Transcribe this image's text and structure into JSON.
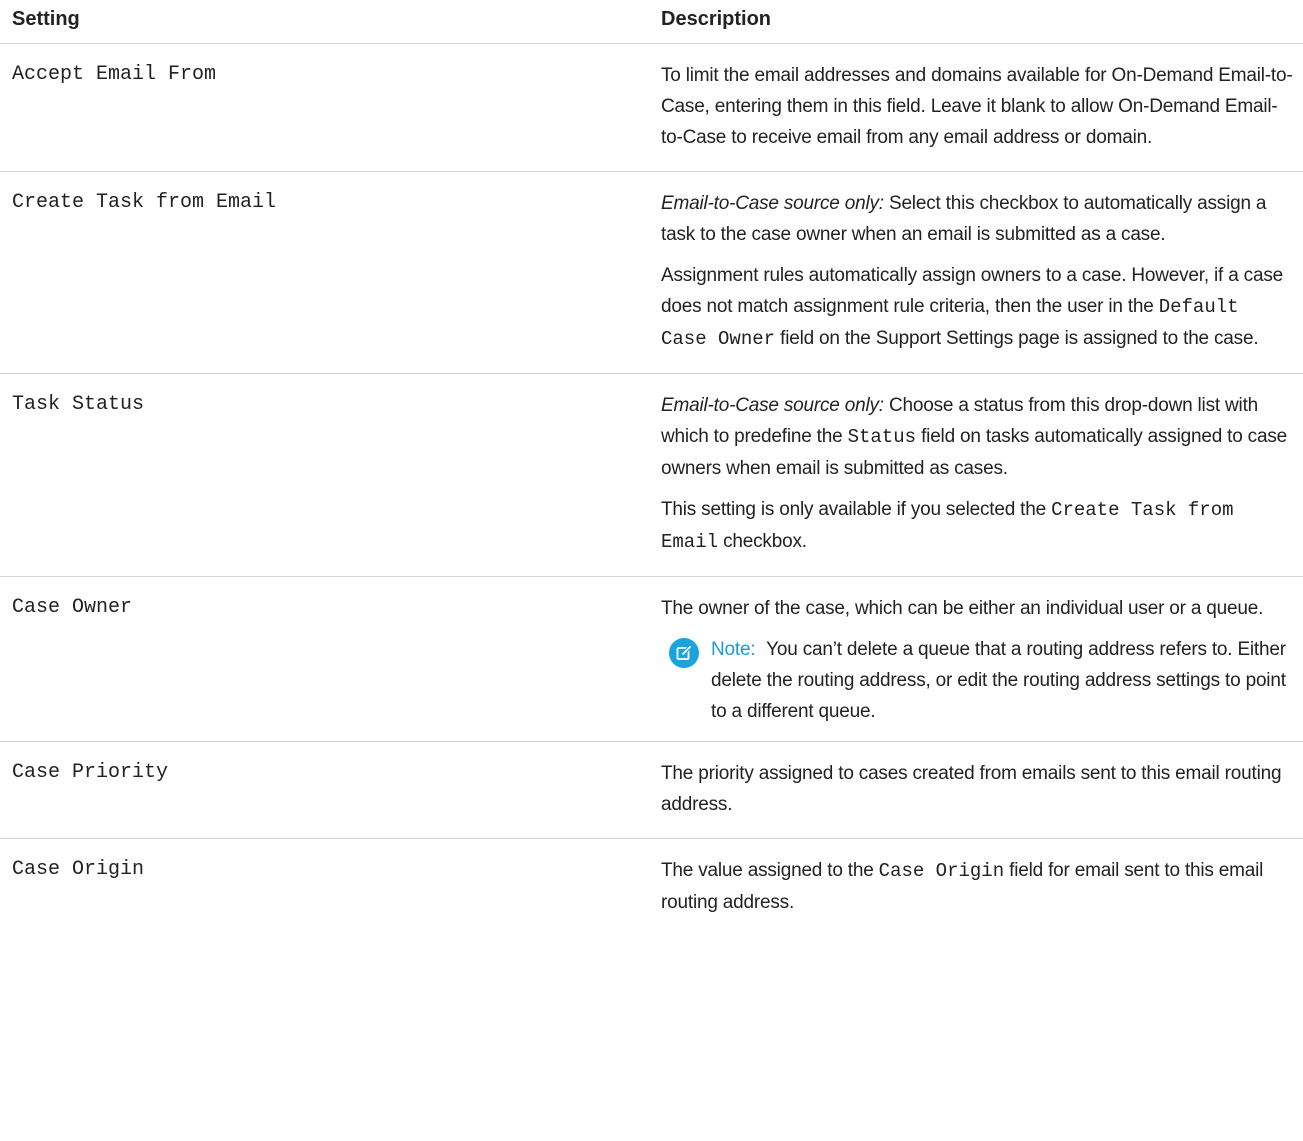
{
  "header": {
    "setting": "Setting",
    "description": "Description"
  },
  "rows": [
    {
      "setting": "Accept Email From",
      "p1": "To limit the email addresses and domains available for On-Demand Email-to-Case, entering them in this field. Leave it blank to allow On-Demand Email-to-Case to receive email from any email address or domain."
    },
    {
      "setting": "Create Task from Email",
      "p1_em": "Email-to-Case source only:",
      "p1_text": " Select this checkbox to automatically assign a task to the case owner when an email is submitted as a case.",
      "p2_a": "Assignment rules automatically assign owners to a case. However, if a case does not match assignment rule criteria, then the user in the ",
      "p2_code": "Default Case Owner",
      "p2_b": " field on the Support Settings page is assigned to the case."
    },
    {
      "setting": "Task Status",
      "p1_em": "Email-to-Case source only:",
      "p1_a": " Choose a status from this drop-down list with which to predefine the ",
      "p1_code": "Status",
      "p1_b": " field on tasks automatically assigned to case owners when email is submitted as cases.",
      "p2_a": "This setting is only available if you selected the ",
      "p2_code": "Create Task from Email",
      "p2_b": " checkbox."
    },
    {
      "setting": "Case Owner",
      "p1": "The owner of the case, which can be either an individual user or a queue.",
      "note_label": "Note:",
      "note_text": "You can’t delete a queue that a routing address refers to. Either delete the routing address, or edit the routing address settings to point to a different queue."
    },
    {
      "setting": "Case Priority",
      "p1": "The priority assigned to cases created from emails sent to this email routing address."
    },
    {
      "setting": "Case Origin",
      "p1_a": "The value assigned to the ",
      "p1_code": "Case Origin",
      "p1_b": " field for email sent to this email routing address."
    }
  ],
  "colors": {
    "note_accent": "#1a9bd7",
    "divider": "#d4d4d4"
  },
  "icons": {
    "note": "edit-note-icon"
  }
}
